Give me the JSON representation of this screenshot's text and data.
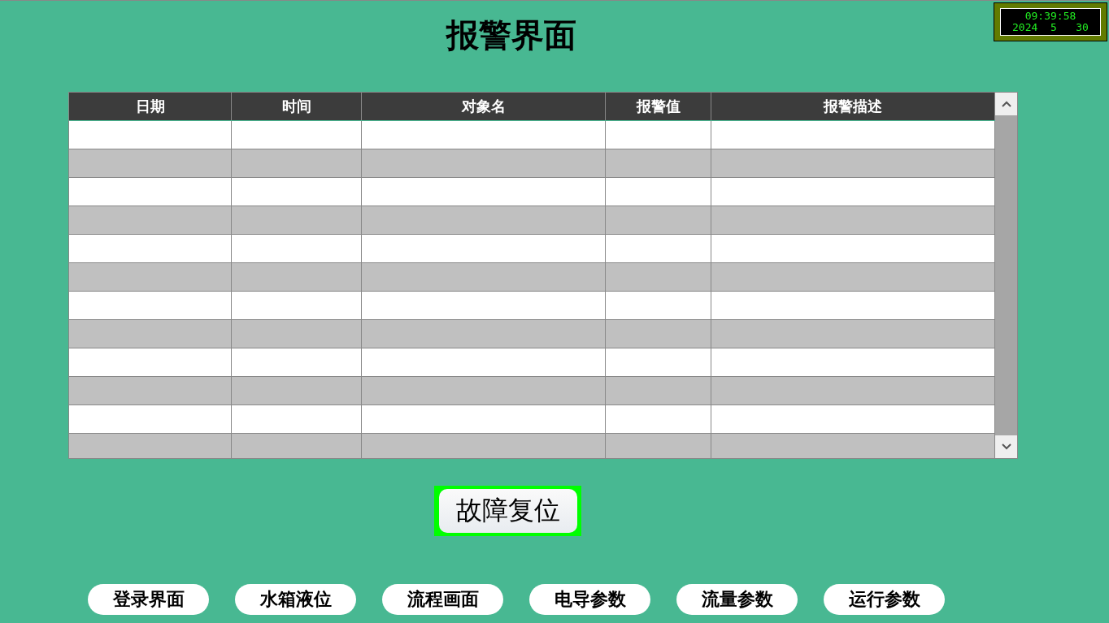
{
  "title": "报警界面",
  "clock": {
    "time": "09:39:58",
    "date": "2024  5   30"
  },
  "table": {
    "columns": [
      "日期",
      "时间",
      "对象名",
      "报警值",
      "报警描述"
    ]
  },
  "reset_button": {
    "label": "故障复位",
    "active": true
  },
  "nav_buttons": [
    "登录界面",
    "水箱液位",
    "流程画面",
    "电导参数",
    "流量参数",
    "运行参数"
  ]
}
